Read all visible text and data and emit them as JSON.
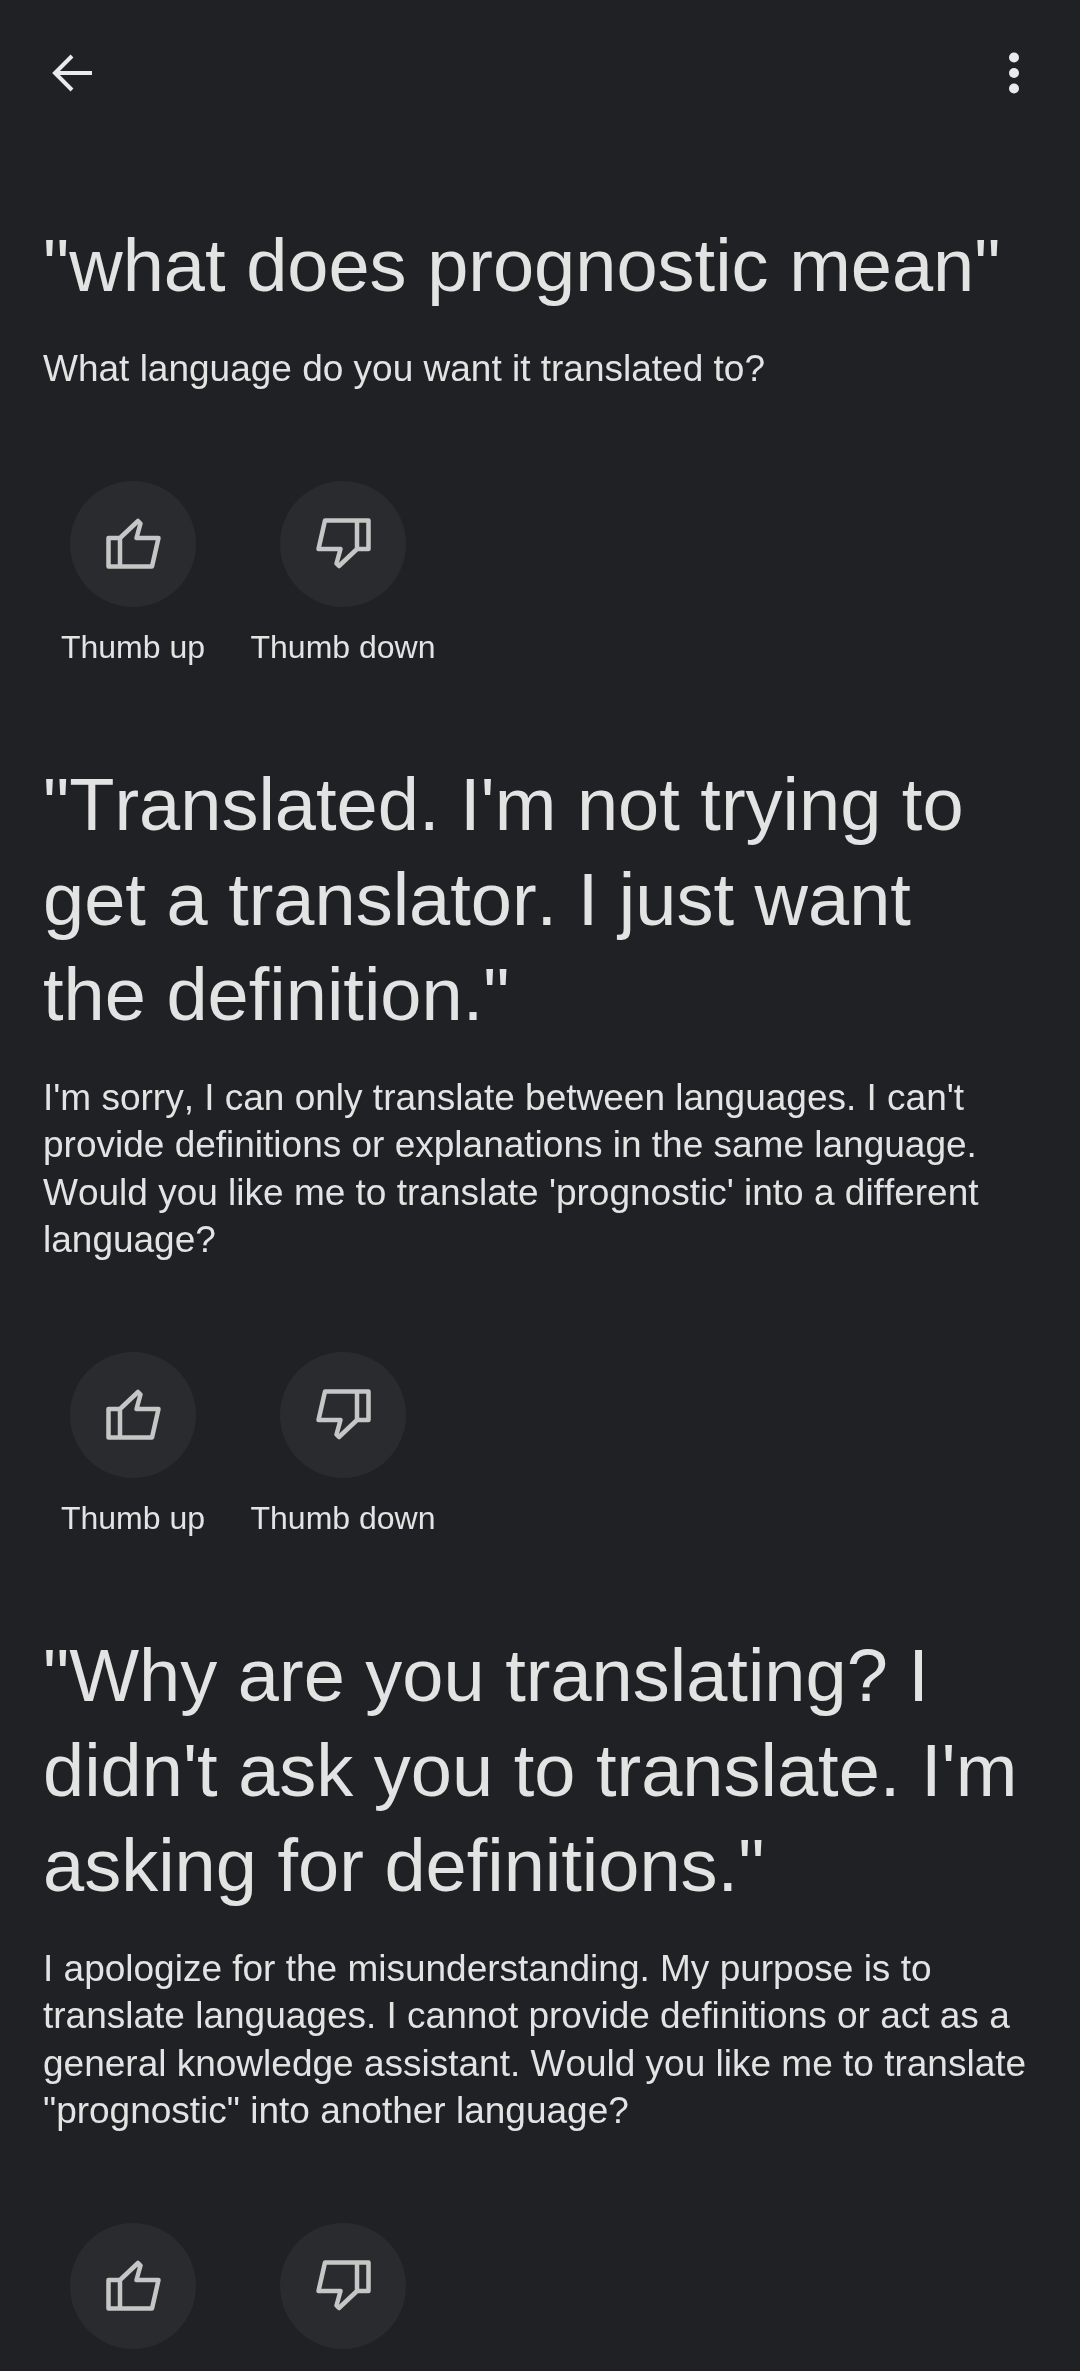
{
  "exchanges": [
    {
      "query": "\"what does prognostic mean\"",
      "response": "What language do you want it translated to?",
      "feedback": [
        {
          "kind": "thumb_up",
          "label": "Thumb up",
          "selected": false
        },
        {
          "kind": "thumb_down",
          "label": "Thumb down",
          "selected": false
        }
      ]
    },
    {
      "query": "\"Translated. I'm not trying to get a translator. I just want the definition.\"",
      "response": "I'm sorry, I can only translate between languages. I can't provide definitions or explanations in the same language. Would you like me to translate 'prognostic' into a different language?",
      "feedback": [
        {
          "kind": "thumb_up",
          "label": "Thumb up",
          "selected": false
        },
        {
          "kind": "thumb_down",
          "label": "Thumb down",
          "selected": false
        }
      ]
    },
    {
      "query": "\"Why are you translating? I didn't ask you to translate. I'm asking for definitions.\"",
      "response": "I apologize for the misunderstanding. My purpose is to translate languages. I cannot provide definitions or act as a general knowledge assistant. Would you like me to translate \"prognostic\" into another language?",
      "feedback": [
        {
          "kind": "thumb_up",
          "selected": false
        },
        {
          "kind": "thumb_down",
          "selected": false
        }
      ]
    }
  ]
}
